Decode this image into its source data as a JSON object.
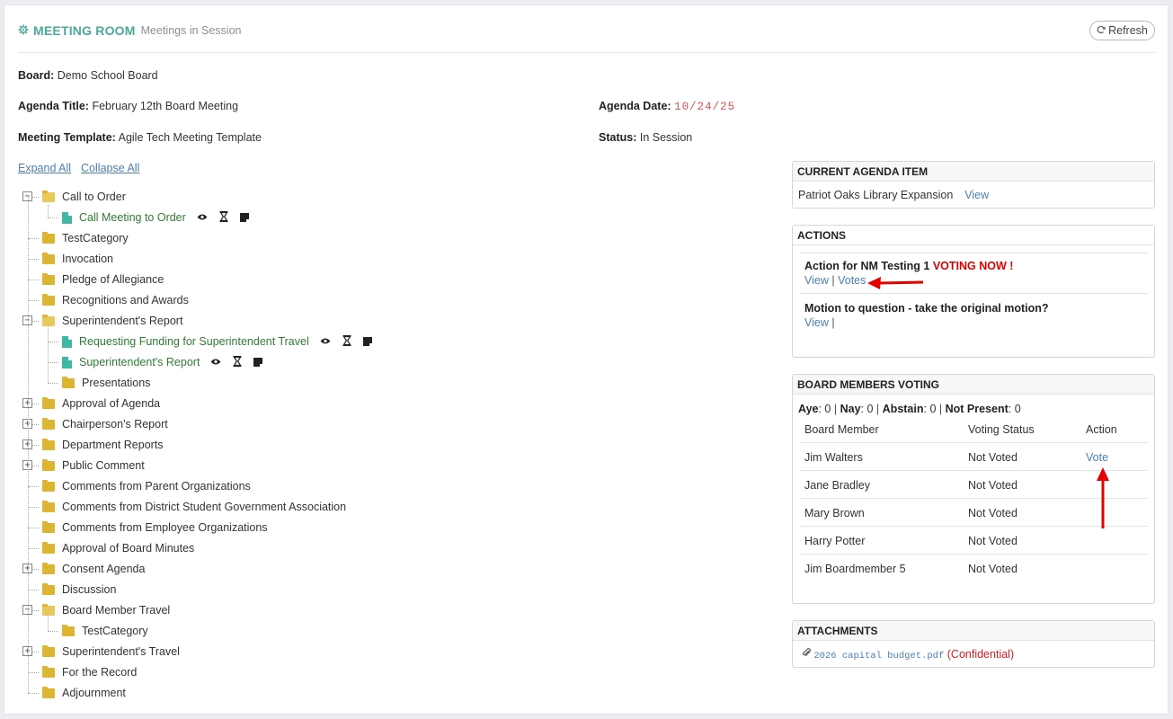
{
  "header": {
    "icon": "gear-icon",
    "title": "MEETING ROOM",
    "subtitle": "Meetings in Session",
    "refresh_label": "Refresh"
  },
  "info": {
    "board_label": "Board:",
    "board_value": "Demo School Board",
    "agenda_title_label": "Agenda Title:",
    "agenda_title_value": "February 12th Board Meeting",
    "agenda_date_label": "Agenda Date:",
    "agenda_date_value": "10/24/25",
    "template_label": "Meeting Template:",
    "template_value": "Agile Tech Meeting Template",
    "status_label": "Status:",
    "status_value": "In Session"
  },
  "tree_controls": {
    "expand_all": "Expand All",
    "collapse_all": "Collapse All"
  },
  "tree": [
    {
      "label": "Call to Order",
      "type": "folder-open",
      "level": 0,
      "expander": "minus"
    },
    {
      "label": "Call Meeting to Order",
      "type": "doc",
      "level": 1,
      "actions": true
    },
    {
      "label": "TestCategory",
      "type": "folder",
      "level": 0
    },
    {
      "label": "Invocation",
      "type": "folder",
      "level": 0
    },
    {
      "label": "Pledge of Allegiance",
      "type": "folder",
      "level": 0
    },
    {
      "label": "Recognitions and Awards",
      "type": "folder",
      "level": 0
    },
    {
      "label": "Superintendent's Report",
      "type": "folder-open",
      "level": 0,
      "expander": "minus"
    },
    {
      "label": "Requesting Funding for Superintendent Travel",
      "type": "doc",
      "level": 1,
      "actions": true
    },
    {
      "label": "Superintendent's Report",
      "type": "doc",
      "level": 1,
      "actions": true
    },
    {
      "label": "Presentations",
      "type": "folder",
      "level": 1
    },
    {
      "label": "Approval of Agenda",
      "type": "folder",
      "level": 0,
      "expander": "plus"
    },
    {
      "label": "Chairperson's Report",
      "type": "folder",
      "level": 0,
      "expander": "plus"
    },
    {
      "label": "Department Reports",
      "type": "folder",
      "level": 0,
      "expander": "plus"
    },
    {
      "label": "Public Comment",
      "type": "folder",
      "level": 0,
      "expander": "plus"
    },
    {
      "label": "Comments from Parent Organizations",
      "type": "folder",
      "level": 0
    },
    {
      "label": "Comments from District Student Government Association",
      "type": "folder",
      "level": 0
    },
    {
      "label": "Comments from Employee Organizations",
      "type": "folder",
      "level": 0
    },
    {
      "label": "Approval of Board Minutes",
      "type": "folder",
      "level": 0
    },
    {
      "label": "Consent Agenda",
      "type": "folder",
      "level": 0,
      "expander": "plus"
    },
    {
      "label": "Discussion",
      "type": "folder",
      "level": 0
    },
    {
      "label": "Board Member Travel",
      "type": "folder-open",
      "level": 0,
      "expander": "minus"
    },
    {
      "label": "TestCategory",
      "type": "folder",
      "level": 1
    },
    {
      "label": "Superintendent's Travel",
      "type": "folder",
      "level": 0,
      "expander": "plus"
    },
    {
      "label": "For the Record",
      "type": "folder",
      "level": 0
    },
    {
      "label": "Adjournment",
      "type": "folder",
      "level": 0
    }
  ],
  "current_item": {
    "heading": "CURRENT AGENDA ITEM",
    "name": "Patriot Oaks Library Expansion",
    "view_label": "View"
  },
  "actions": {
    "heading": "ACTIONS",
    "items": [
      {
        "title": "Action for NM Testing 1",
        "flag": "VOTING NOW !",
        "view_label": "View",
        "sep": "|",
        "votes_label": "Votes"
      },
      {
        "title": "Motion to question - take the original motion?",
        "view_label": "View",
        "sep": "|"
      }
    ]
  },
  "voting": {
    "heading": "BOARD MEMBERS VOTING",
    "tally": [
      {
        "label": "Aye",
        "value": ": 0"
      },
      {
        "label": "Nay",
        "value": ": 0"
      },
      {
        "label": "Abstain",
        "value": ": 0"
      },
      {
        "label": "Not Present",
        "value": ": 0"
      }
    ],
    "sep": "|",
    "columns": [
      "Board Member",
      "Voting Status",
      "Action"
    ],
    "rows": [
      {
        "member": "Jim Walters",
        "status": "Not Voted",
        "action": "Vote"
      },
      {
        "member": "Jane Bradley",
        "status": "Not Voted",
        "action": ""
      },
      {
        "member": "Mary Brown",
        "status": "Not Voted",
        "action": ""
      },
      {
        "member": "Harry Potter",
        "status": "Not Voted",
        "action": ""
      },
      {
        "member": "Jim Boardmember 5",
        "status": "Not Voted",
        "action": ""
      }
    ]
  },
  "attachments": {
    "heading": "ATTACHMENTS",
    "icon": "paperclip-icon",
    "file": "2026 capital budget.pdf",
    "note": "(Confidential)"
  },
  "colors": {
    "accent": "#4aa89a",
    "link": "#4a7fb8",
    "voting_now": "#e00000",
    "annotation_arrow": "#e60000",
    "folder": "#dcb532",
    "doc": "#3fb8a5"
  }
}
